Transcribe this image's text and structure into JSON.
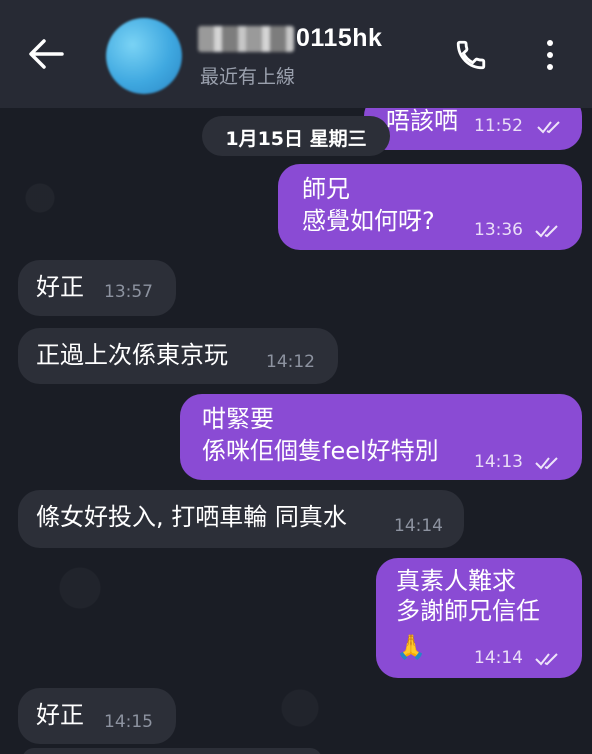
{
  "header": {
    "contact_name": "0115hk",
    "status": "最近有上線"
  },
  "date_separator": "1月15日 星期三",
  "messages": [
    {
      "direction": "out",
      "lines": [
        "唔該哂"
      ],
      "time": "11:52"
    },
    {
      "direction": "out",
      "lines": [
        "師兄",
        "感覺如何呀?"
      ],
      "time": "13:36"
    },
    {
      "direction": "in",
      "lines": [
        "好正"
      ],
      "time": "13:57"
    },
    {
      "direction": "in",
      "lines": [
        "正過上次係東京玩"
      ],
      "time": "14:12"
    },
    {
      "direction": "out",
      "lines": [
        "咁緊要",
        "係咪佢個隻feel好特別"
      ],
      "time": "14:13"
    },
    {
      "direction": "in",
      "lines": [
        "條女好投入, 打哂車輪 同真水"
      ],
      "time": "14:14"
    },
    {
      "direction": "out",
      "lines": [
        "真素人難求",
        "多謝師兄信任",
        "🙏"
      ],
      "time": "14:14"
    },
    {
      "direction": "in",
      "lines": [
        "好正"
      ],
      "time": "14:15"
    }
  ],
  "colors": {
    "background": "#1a1d25",
    "header": "#272a34",
    "incoming_bubble": "#2c2f38",
    "outgoing_bubble": "#8a4bd4"
  },
  "icons": [
    "back-arrow-icon",
    "phone-icon",
    "more-vert-icon",
    "double-check-icon",
    "pray-emoji-icon"
  ]
}
